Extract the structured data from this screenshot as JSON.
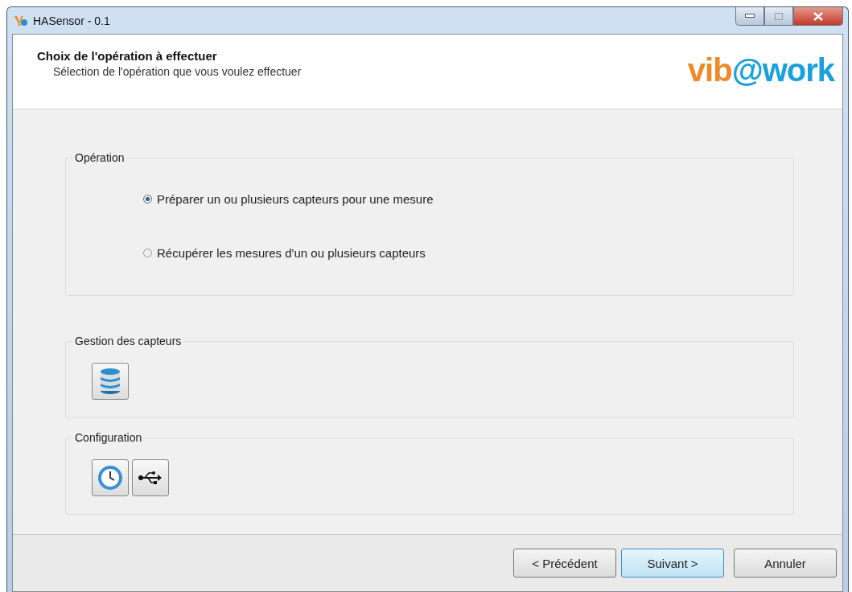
{
  "window": {
    "title": "HASensor - 0.1"
  },
  "header": {
    "title": "Choix de l'opération à effectuer",
    "subtitle": "Sélection de l'opération que vous voulez effectuer",
    "logo": [
      "vib",
      "@work"
    ]
  },
  "groups": [
    {
      "kind": "radios",
      "label": "Opération",
      "options": [
        {
          "label": "Préparer un ou plusieurs capteurs pour une mesure",
          "selected": true
        },
        {
          "label": "Récupérer les mesures d'un ou plusieurs capteurs",
          "selected": false
        }
      ]
    },
    {
      "kind": "tools",
      "label": "Gestion des capteurs",
      "tools": [
        {
          "kind": "database"
        }
      ]
    },
    {
      "kind": "tools",
      "label": "Configuration",
      "tools": [
        {
          "kind": "clock"
        },
        {
          "kind": "usb"
        }
      ]
    }
  ],
  "buttons": [
    {
      "label": "< Précédent",
      "default": false
    },
    {
      "label": "Suivant >",
      "default": true
    },
    {
      "label": "Annuler",
      "default": false
    }
  ]
}
